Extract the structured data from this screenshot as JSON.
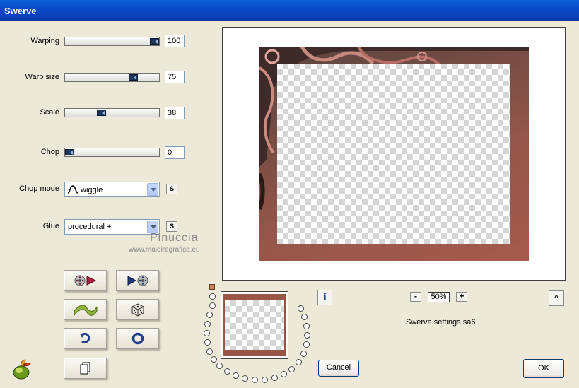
{
  "window": {
    "title": "Swerve"
  },
  "controls": {
    "warping": {
      "label": "Warping",
      "value": "100",
      "level": 1.0
    },
    "warp_size": {
      "label": "Warp size",
      "value": "75",
      "level": 0.75
    },
    "scale": {
      "label": "Scale",
      "value": "38",
      "level": 0.38
    },
    "chop": {
      "label": "Chop",
      "value": "0",
      "level": 0.0
    },
    "chop_mode": {
      "label": "Chop mode",
      "selected": "wiggle",
      "s_label": "S"
    },
    "glue": {
      "label": "Glue",
      "selected": "procedural +",
      "s_label": "S"
    }
  },
  "watermark": {
    "line1": "Pinuccia",
    "line2": "www.maidiregrafica.eu"
  },
  "zoom": {
    "minus": "-",
    "value": "50%",
    "plus": "+"
  },
  "settings_file": "Swerve settings.sa6",
  "buttons": {
    "cancel": "Cancel",
    "ok": "OK",
    "info": "i",
    "collapse": "^"
  },
  "icons": {
    "play_forward": "film-reel-play-icon",
    "play_back": "play-film-reel-icon",
    "wave": "green-wave-icon",
    "dice": "dice-icon",
    "undo": "undo-arrow-icon",
    "reset": "blue-ring-icon",
    "copy": "copy-page-icon",
    "app": "fruit-logo-icon"
  }
}
